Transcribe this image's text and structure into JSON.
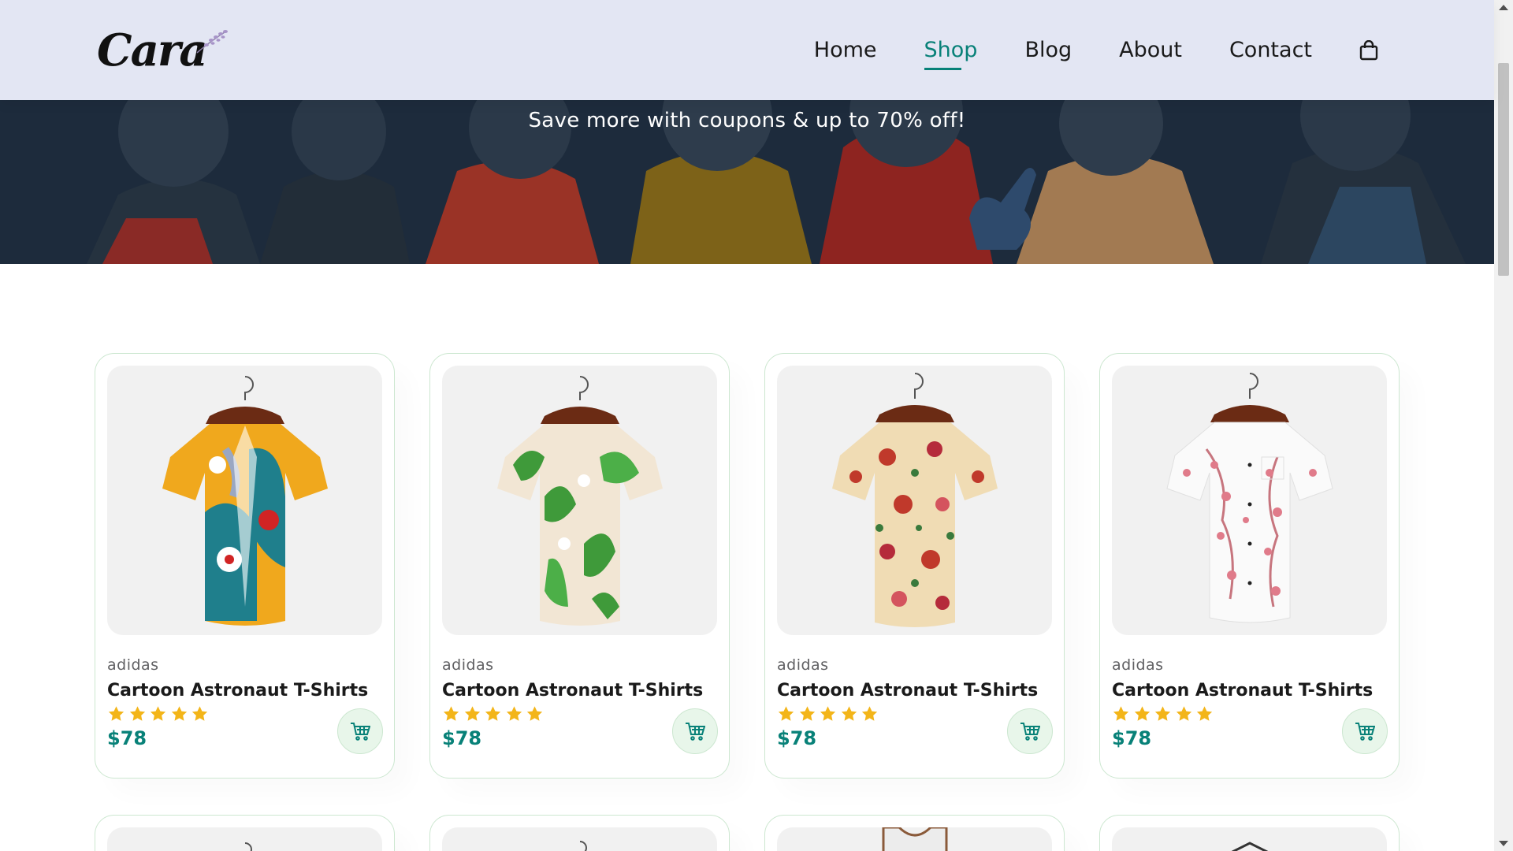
{
  "brand": {
    "logo_text": "Cara",
    "logo_icon": "lavender-sprig-icon"
  },
  "nav": {
    "items": [
      {
        "label": "Home",
        "active": false
      },
      {
        "label": "Shop",
        "active": true
      },
      {
        "label": "Blog",
        "active": false
      },
      {
        "label": "About",
        "active": false
      },
      {
        "label": "Contact",
        "active": false
      }
    ],
    "cart_icon": "shopping-bag-icon"
  },
  "hero": {
    "text": "Save more with coupons & up to 70% off!"
  },
  "products": [
    {
      "brand": "adidas",
      "name": "Cartoon Astronaut T-Shirts",
      "rating": 5,
      "price": "$78",
      "image": "abstract-floral-shirt"
    },
    {
      "brand": "adidas",
      "name": "Cartoon Astronaut T-Shirts",
      "rating": 5,
      "price": "$78",
      "image": "tropical-leaf-shirt"
    },
    {
      "brand": "adidas",
      "name": "Cartoon Astronaut T-Shirts",
      "rating": 5,
      "price": "$78",
      "image": "rose-print-shirt"
    },
    {
      "brand": "adidas",
      "name": "Cartoon Astronaut T-Shirts",
      "rating": 5,
      "price": "$78",
      "image": "blossom-white-shirt"
    }
  ],
  "colors": {
    "accent": "#088178",
    "header_bg": "#e3e6f3",
    "star": "#f3b519",
    "card_border": "#cce7d0",
    "cart_bg": "#e8f6ea"
  }
}
